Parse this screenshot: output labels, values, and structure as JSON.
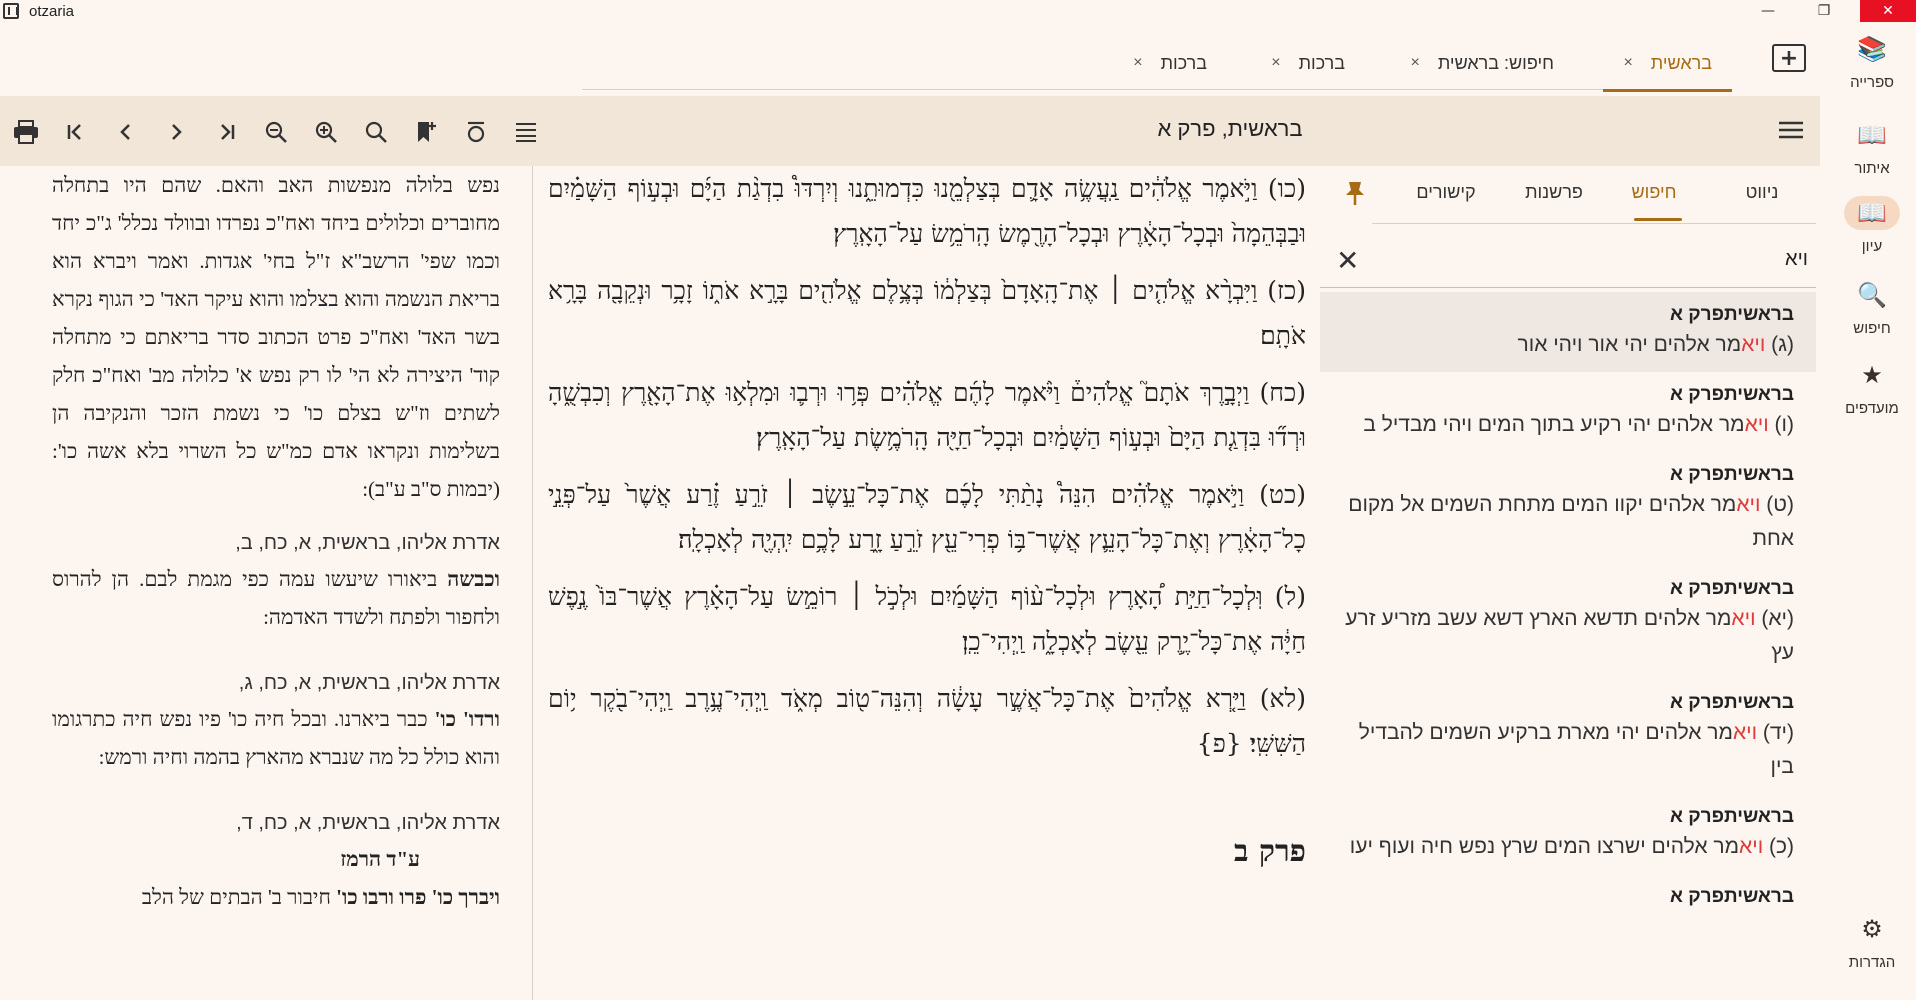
{
  "window": {
    "title": "otzaria",
    "minimize": "—",
    "maximize": "❐",
    "close": "✕"
  },
  "rail": [
    {
      "label": "ספרייה",
      "icon": "library-icon",
      "glyph": "📚"
    },
    {
      "label": "איתור",
      "icon": "find-book-icon",
      "glyph": "📖"
    },
    {
      "label": "עיון",
      "icon": "reading-icon",
      "glyph": "📖"
    },
    {
      "label": "חיפוש",
      "icon": "search-icon",
      "glyph": "🔍"
    },
    {
      "label": "מועדפים",
      "icon": "star-icon",
      "glyph": "★"
    },
    {
      "label": "הגדרות",
      "icon": "settings-icon",
      "glyph": "⚙"
    }
  ],
  "tabs": [
    {
      "label": "בראשית",
      "close": "×"
    },
    {
      "label": "חיפוש: בראשית",
      "close": "×"
    },
    {
      "label": "ברכות",
      "close": "×"
    },
    {
      "label": "ברכות",
      "close": "×"
    }
  ],
  "toolbar": {
    "book_title": "בראשית, פרק א"
  },
  "commentary": {
    "p1": "נפש בלולה מנפשות האב והאם. שהם היו בתחלה מחוברים וכלולים ביחד ואח\"כ נפרדו ובוולד נכלל' ג\"כ יחד וכמו שפי' הרשב\"א ז\"ל בחי' אגדות. ואמר ויברא הוא בריאת הנשמה והוא בצלמו והוא עיקר האד' כי הגוף נקרא בשר האד' ואח\"כ פרט הכתוב סדר בריאתם כי מתחלה קוד' היצירה לא הי' לו רק נפש א' כלולה מב' ואח\"כ חלק לשתים וז\"ש בצלם כו' כי נשמת הזכר והנקיבה הן בשלימות ונקראו אדם כמ\"ש כל השרוי בלא אשה כו': (יבמות ס\"ב ע\"ב):",
    "ref1": "אדרת אליהו, בראשית, א, כח, ב,",
    "p2_bold": "וכבשה",
    "p2": " ביאורו שיעשו עמה כפי מגמת לבם. הן להרוס ולחפור ולפתח ולשדד האדמה:",
    "ref2": "אדרת אליהו, בראשית, א, כח, ג,",
    "p3_bold": "ורדו' כו'",
    "p3": " כבר ביארנו. ובכל חיה כו' פיו נפש חיה כתרגומו והוא כולל כל מה שנברא מהארץ בהמה וחיה ורמש:",
    "ref3": "אדרת אליהו, בראשית, א, כח, ד,",
    "p4_bold": "ע\"ד הרמז",
    "p5_bold": "ויברך כו' פרו ורבו כו'",
    "p5": " חיבור ב' הבתים של הלב"
  },
  "main_text": {
    "v26": "(כו) וַיֹּ֣אמֶר אֱלֹהִ֔ים נַֽעֲשֶׂ֥ה אָדָ֛ם בְּצַלְמֵ֖נוּ כִּדְמוּתֵ֑נוּ וְיִרְדּוּ֩ בִדְגַ֨ת הַיָּ֜ם וּבְע֣וֹף הַשָּׁמַ֗יִם וּבַבְּהֵמָה֙ וּבְכָל־הָאָ֔רֶץ וּבְכָל־הָרֶ֖מֶשׂ הָֽרֹמֵ֥שׂ עַל־הָאָֽרֶץ׃",
    "v27": "(כז) וַיִּבְרָ֨א אֱלֹהִ֤ים ׀ אֶת־הָֽאָדָם֙ בְּצַלְמ֔וֹ בְּצֶ֥לֶם אֱלֹהִ֖ים בָּרָ֣א אֹת֑וֹ זָכָ֥ר וּנְקֵבָ֖ה בָּרָ֥א אֹתָֽם׃",
    "v28": "(כח) וַיְבָ֣רֶךְ אֹתָם֮ אֱלֹהִים֒ וַיֹּ֨אמֶר לָהֶ֜ם אֱלֹהִ֗ים פְּר֥וּ וּרְב֛וּ וּמִלְא֥וּ אֶת־הָאָ֖רֶץ וְכִבְשֻׁ֑הָ וּרְד֞וּ בִּדְגַ֤ת הַיָּם֙ וּבְע֣וֹף הַשָּׁמַ֔יִם וּבְכָל־חַיָּ֖ה הָֽרֹמֶ֥שֶׂת עַל־הָאָֽרֶץ׃",
    "v29": "(כט) וַיֹּ֣אמֶר אֱלֹהִ֗ים הִנֵּה֩ נָתַ֨תִּי לָכֶ֜ם אֶת־כָּל־עֵ֣שֶׂב ׀ זֹרֵ֣עַ זֶ֗רַע אֲשֶׁר֙ עַל־פְּנֵ֣י כָל־הָאָ֔רֶץ וְאֶת־כָּל־הָעֵ֛ץ אֲשֶׁר־בּ֥וֹ פְרִי־עֵ֖ץ זֹרֵ֣עַ זָ֑רַע לָכֶ֥ם יִֽהְיֶ֖ה לְאָכְלָֽה׃",
    "v30": "(ל) וּֽלְכָל־חַיַּ֣ת הָ֠אָרֶץ וּלְכָל־ע֨וֹף הַשָּׁמַ֜יִם וּלְכֹ֣ל ׀ רוֹמֵ֣שׂ עַל־הָאָ֗רֶץ אֲשֶׁר־בּוֹ֙ נֶ֣פֶשׁ חַיָּ֔ה אֶת־כָּל־יֶ֥רֶק עֵ֖שֶׂב לְאָכְלָ֑ה וַֽיְהִי־כֵֽן׃",
    "v31": "(לא) וַיַּ֤רְא אֱלֹהִים֙ אֶת־כָּל־אֲשֶׁ֣ר עָשָׂ֔ה וְהִנֵּה־ט֖וֹב מְאֹ֑ד וַֽיְהִי־עֶ֥רֶב וַֽיְהִי־בֹ֖קֶר י֥וֹם הַשִּׁשִּֽׁי׃ {פ}",
    "next_chapter": "פרק ב"
  },
  "sidepanel": {
    "tabs": [
      "ניווט",
      "חיפוש",
      "פרשנות",
      "קישורים"
    ],
    "search_value": "ויא",
    "clear": "✕",
    "results": [
      {
        "title": "בראשיתפרק א",
        "pre": "(ג) ",
        "hit": "ויא",
        "post": "מר אלהים יהי אור ויהי אור"
      },
      {
        "title": "בראשיתפרק א",
        "pre": "(ו) ",
        "hit": "ויא",
        "post": "מר אלהים יהי רקיע בתוך המים ויהי מבדיל ב"
      },
      {
        "title": "בראשיתפרק א",
        "pre": "(ט) ",
        "hit": "ויא",
        "post": "מר אלהים יקוו המים מתחת השמים אל מקום אחת"
      },
      {
        "title": "בראשיתפרק א",
        "pre": "(יא) ",
        "hit": "ויא",
        "post": "מר אלהים תדשא הארץ דשא עשב מזריע זרע עץ"
      },
      {
        "title": "בראשיתפרק א",
        "pre": "(יד) ",
        "hit": "ויא",
        "post": "מר אלהים יהי מארת ברקיע השמים להבדיל בין"
      },
      {
        "title": "בראשיתפרק א",
        "pre": "(כ) ",
        "hit": "ויא",
        "post": "מר אלהים ישרצו המים שרץ נפש חיה ועוף יעו"
      },
      {
        "title": "בראשיתפרק א",
        "pre": "",
        "hit": "",
        "post": ""
      }
    ]
  }
}
